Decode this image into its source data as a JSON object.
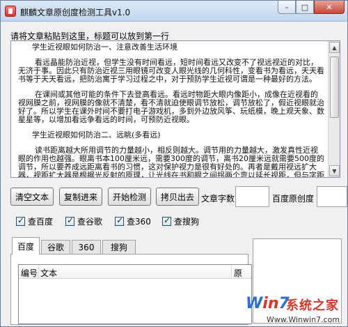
{
  "window": {
    "title": "麒麟文章原创度检测工具v1.0",
    "controls": {
      "minimize": "–",
      "maximize": "□",
      "close": "✕"
    }
  },
  "editor": {
    "label": "请将文章粘贴到这里，标题可以放到第一行",
    "paragraphs": [
      "学生近视眼如何防治一、注意改善生活环境",
      "看远晶能防治近视，但学生没有时间看远，短时间看远又改变不了视远视近的对比，无济于事。因此只有防治近视三用眼镜可改变人眼光线的几何科性，变看书为看远，天天看书等于天天看远，把防治寓于学习过程之中，对于预防学生近视可谓是一种最好的方法。",
      "在课间或其他可能的条件下去登高看远。看远时物距大眼内像距小，成像在近视看的视网膜之前，视网膜的像就不清楚，看不清就迫使眼调节放松，调节放松了，假近视眼就治好了。所以学生在课外时间不要打电子游戏机，多到外边放风筝、玩纸模，晚上观天象、数星星等，以增加看远争看远的时间，可预防近视眼。",
      "学生近视眼如何防治二、远眺(多看远)",
      "读书距离越大所用调节的力量越小，相反则越大。调节用的力量越大，激发真性近视眼的作用也越强。眼离书本100厘米远，需要300度的调节，离书20厘米远就需要500度的调节，所以要养成远距离看书的习惯，这对保护视力是很有好处的。再者是戴用视远扩大器，视距扩大器是根据光反射的原理，让光线在书和眼之间拐两个弯以延长视距，但与字距离不延长，它的缺"
    ],
    "scroll": {
      "up": "▲",
      "down": "▼"
    }
  },
  "toolbar": {
    "clear_label": "清空文本",
    "paste_label": "复制进来",
    "detect_label": "开始检测",
    "copy_out_label": "拷贝出去",
    "char_count_label": "文章字数",
    "char_count_value": "",
    "baidu_originality_label": "百度原创度",
    "baidu_originality_value": ""
  },
  "engines": [
    {
      "label": "查百度",
      "checked": true
    },
    {
      "label": "查谷歌",
      "checked": true
    },
    {
      "label": "查360",
      "checked": true
    },
    {
      "label": "查搜狗",
      "checked": true
    }
  ],
  "results": {
    "tabs": [
      "百度",
      "谷歌",
      "360",
      "搜狗"
    ],
    "active_tab": 0,
    "columns": [
      "编号",
      "文本",
      "原"
    ]
  },
  "watermark": {
    "logo_w": "W",
    "logo_in": "in",
    "logo_7": "7",
    "name": "系统之家",
    "url": "Www.Winwin7.com"
  }
}
